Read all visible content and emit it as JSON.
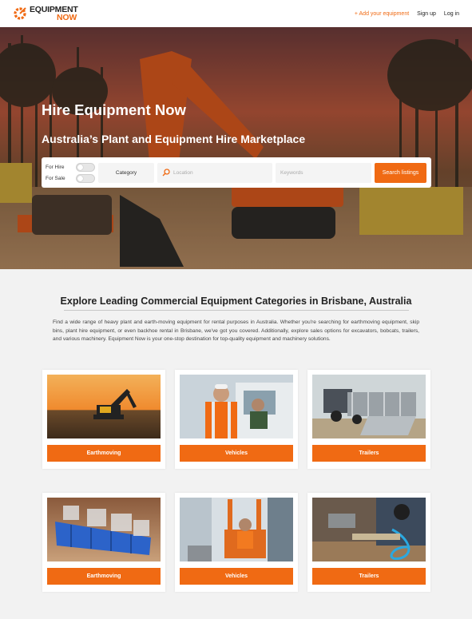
{
  "brand": {
    "line1": "EQUIPMENT",
    "line2": "NOW",
    "accent_color": "#f06a13"
  },
  "nav": {
    "add_label": "+ Add your equipment",
    "signup_label": "Sign up",
    "login_label": "Log in"
  },
  "hero": {
    "title": "Hire Equipment Now",
    "subtitle": "Australia’s Plant and Equipment Hire Marketplace"
  },
  "search": {
    "toggle_hire": "For Hire",
    "toggle_sale": "For Sale",
    "category": "Category",
    "location_placeholder": "Location",
    "keywords_placeholder": "Keywords",
    "button": "Search listings"
  },
  "section": {
    "title": "Explore Leading Commercial Equipment Categories in Brisbane, Australia",
    "description": "Find a wide range of heavy plant and earth-moving equipment for rental purposes in Australia. Whether you're searching for earthmoving equipment, skip bins, plant hire equipment, or even backhoe rental in Brisbane, we've got you covered. Additionally, explore sales options for excavators, bobcats, trailers, and various machinery. Equipment Now is your one-stop destination for top-quality equipment and machinery solutions."
  },
  "cards": [
    {
      "label": "Earthmoving",
      "image": "excavator-sunset"
    },
    {
      "label": "Vehicles",
      "image": "workers-truck"
    },
    {
      "label": "Trailers",
      "image": "trailer-ramp"
    },
    {
      "label": "Earthmoving",
      "image": "skip-bin"
    },
    {
      "label": "Vehicles",
      "image": "forklift-worker"
    },
    {
      "label": "Trailers",
      "image": "power-tool"
    }
  ]
}
